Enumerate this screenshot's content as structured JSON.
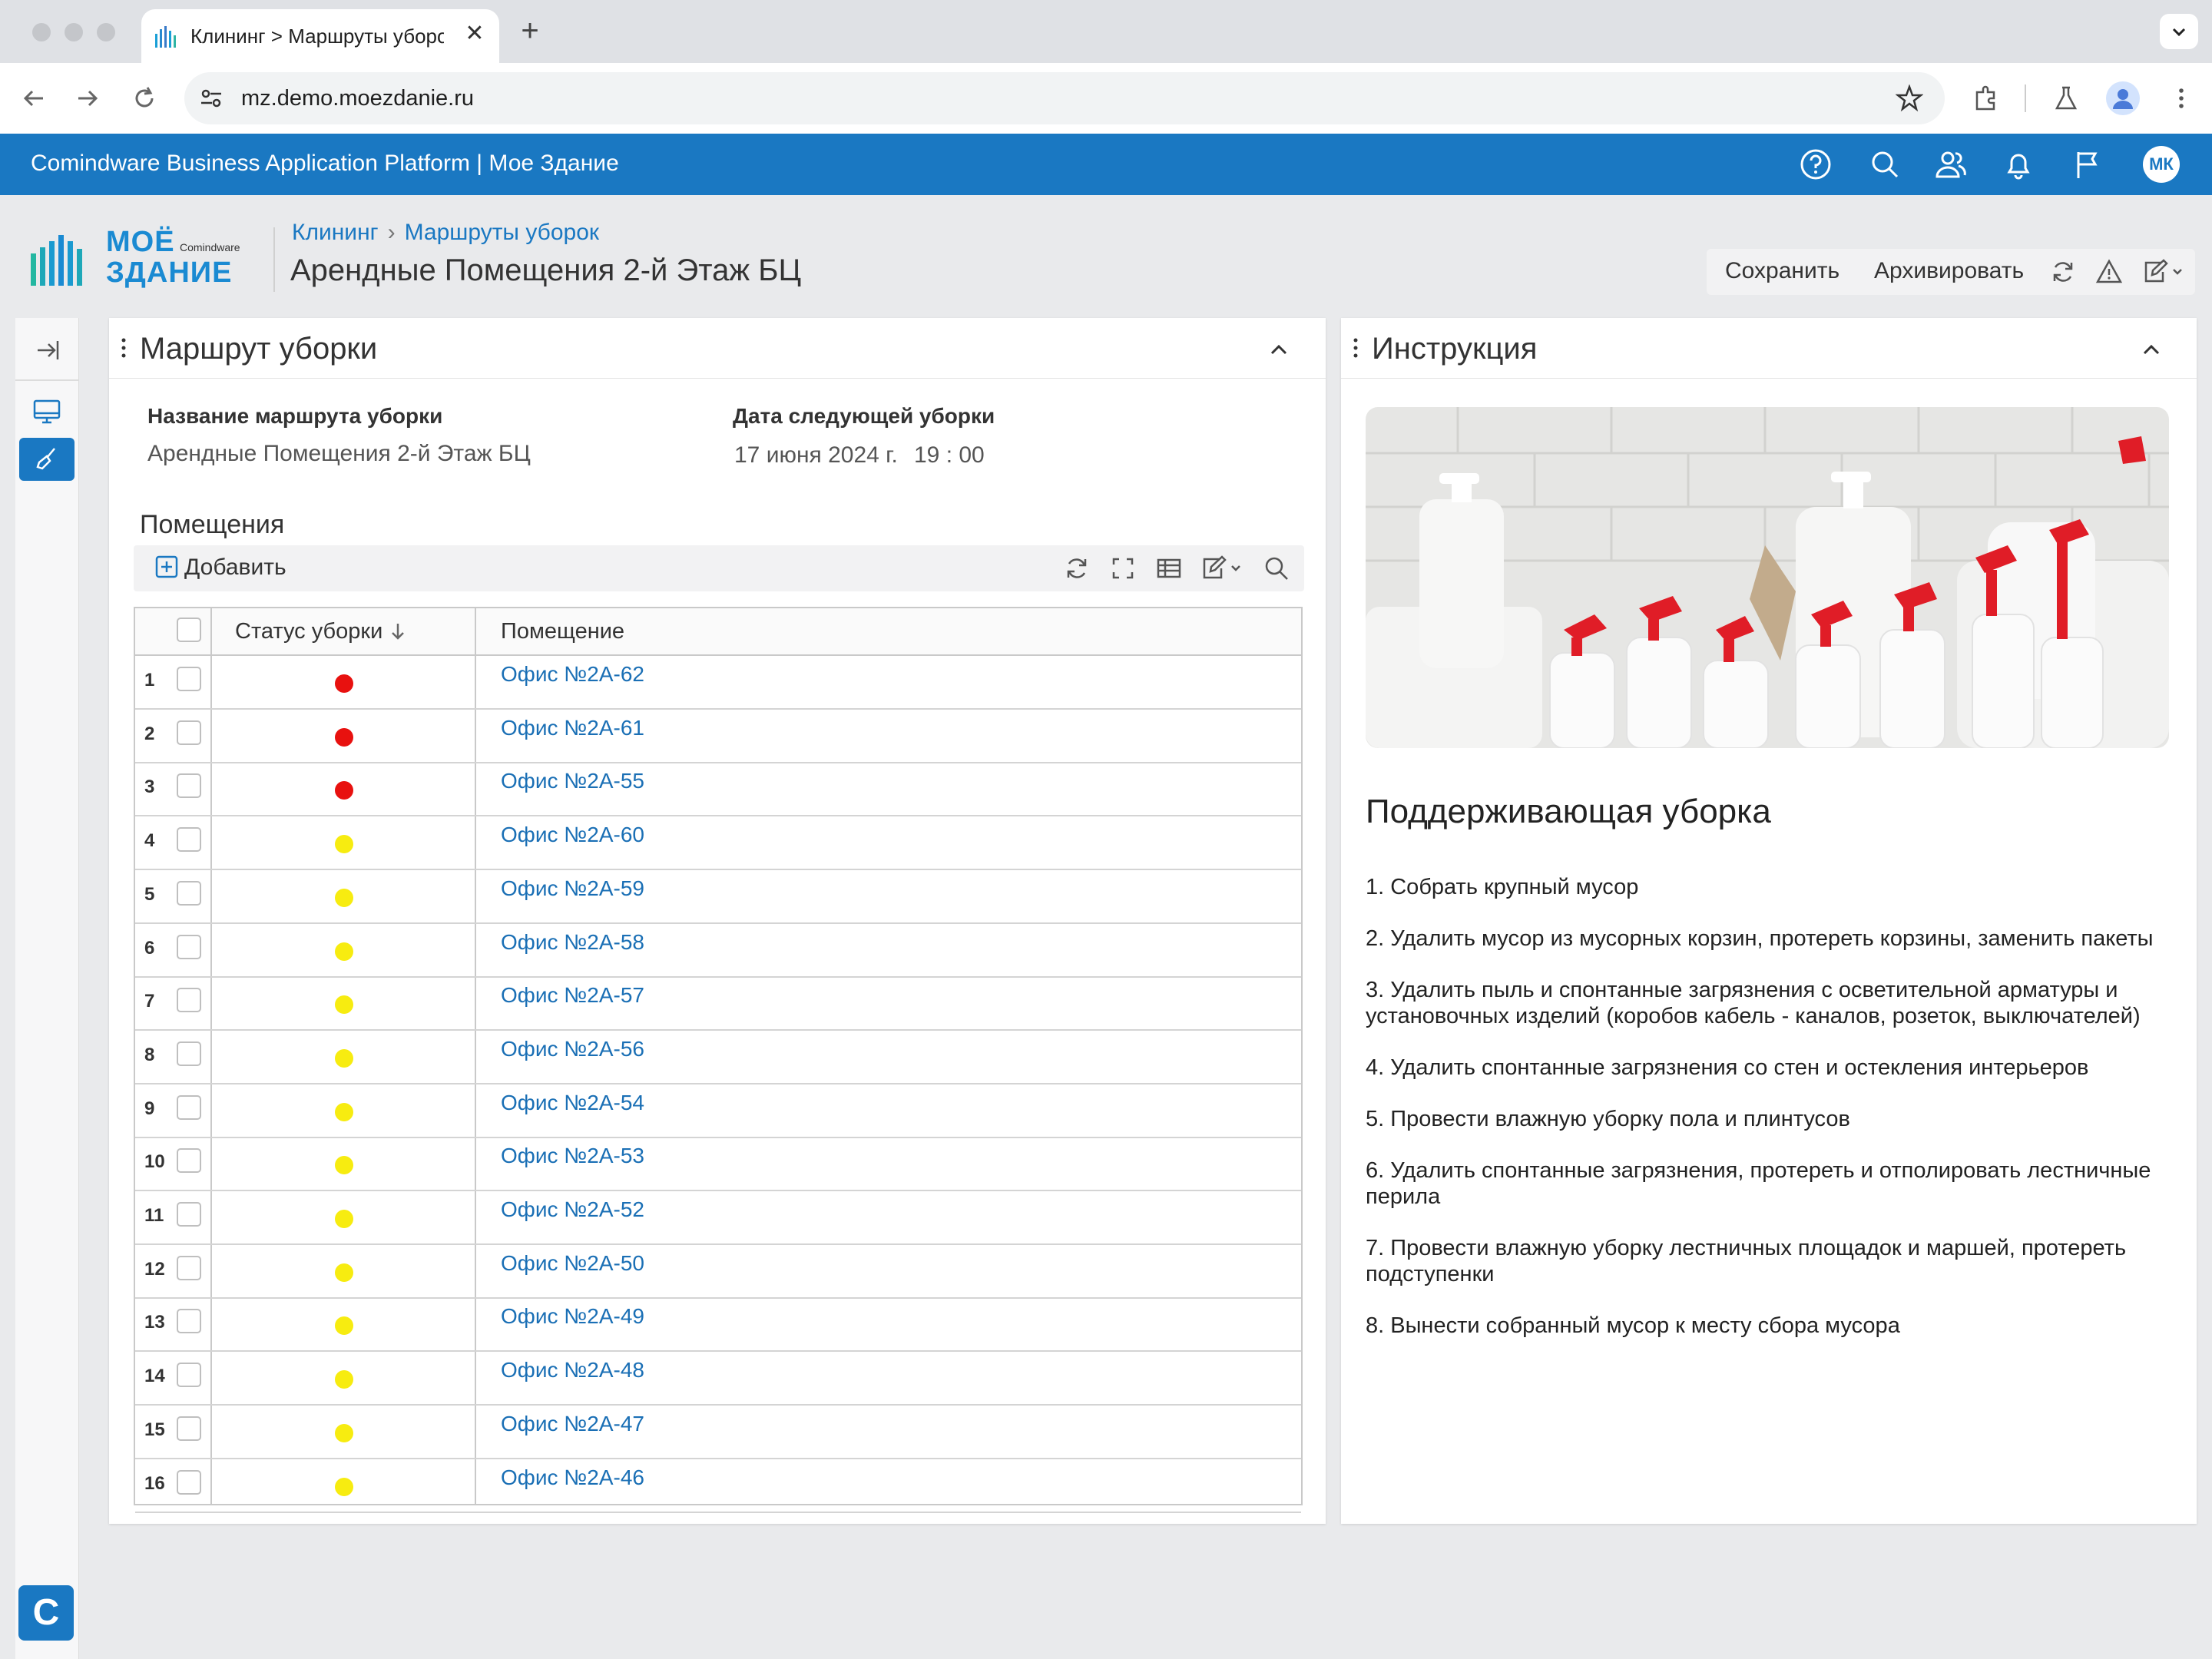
{
  "browser": {
    "tab_title": "Клининг > Маршруты уборок",
    "url": "mz.demo.moezdanie.ru"
  },
  "appbar": {
    "title": "Comindware Business Application Platform  |  Мое Здание",
    "user_initials": "МК"
  },
  "logo": {
    "line1": "МОЁ",
    "line2": "ЗДАНИЕ",
    "vendor": "Comindware"
  },
  "breadcrumbs": [
    "Клининг",
    "Маршруты уборок"
  ],
  "page_title": "Арендные Помещения 2-й Этаж БЦ",
  "actions": {
    "save": "Сохранить",
    "archive": "Архивировать"
  },
  "route_panel": {
    "title": "Маршрут уборки",
    "name_label": "Название маршрута уборки",
    "name_value": "Арендные Помещения 2-й Этаж БЦ",
    "date_label": "Дата следующей уборки",
    "date_value": "17 июня 2024 г.",
    "time_value": "19 : 00",
    "rooms_title": "Помещения",
    "add_label": "Добавить",
    "columns": [
      "Статус уборки",
      "Помещение"
    ],
    "status_colors": {
      "red": "#e8110f",
      "yellow": "#f7ec10"
    },
    "rows": [
      {
        "n": "1",
        "status": "red",
        "room": "Офис №2А-62"
      },
      {
        "n": "2",
        "status": "red",
        "room": "Офис №2А-61"
      },
      {
        "n": "3",
        "status": "red",
        "room": "Офис №2А-55"
      },
      {
        "n": "4",
        "status": "yellow",
        "room": "Офис №2А-60"
      },
      {
        "n": "5",
        "status": "yellow",
        "room": "Офис №2А-59"
      },
      {
        "n": "6",
        "status": "yellow",
        "room": "Офис №2А-58"
      },
      {
        "n": "7",
        "status": "yellow",
        "room": "Офис №2А-57"
      },
      {
        "n": "8",
        "status": "yellow",
        "room": "Офис №2А-56"
      },
      {
        "n": "9",
        "status": "yellow",
        "room": "Офис №2А-54"
      },
      {
        "n": "10",
        "status": "yellow",
        "room": "Офис №2А-53"
      },
      {
        "n": "11",
        "status": "yellow",
        "room": "Офис №2А-52"
      },
      {
        "n": "12",
        "status": "yellow",
        "room": "Офис №2А-50"
      },
      {
        "n": "13",
        "status": "yellow",
        "room": "Офис №2А-49"
      },
      {
        "n": "14",
        "status": "yellow",
        "room": "Офис №2А-48"
      },
      {
        "n": "15",
        "status": "yellow",
        "room": "Офис №2А-47"
      },
      {
        "n": "16",
        "status": "yellow",
        "room": "Офис №2А-46"
      }
    ]
  },
  "instruction_panel": {
    "title": "Инструкция",
    "heading": "Поддерживающая уборка",
    "steps": [
      "1. Собрать крупный мусор",
      "2. Удалить мусор из мусорных корзин, протереть корзины, заменить пакеты",
      "3. Удалить пыль и спонтанные загрязнения с осветительной арматуры и установочных изделий (коробов кабель - каналов, розеток, выключателей)",
      "4. Удалить спонтанные загрязнения со стен и остекления интерьеров",
      "5. Провести влажную уборку пола и плинтусов",
      "6. Удалить спонтанные загрязнения, протереть и отполировать лестничные перила",
      "7. Провести влажную уборку лестничных площадок и маршей, протереть подступенки",
      "8. Вынести собранный мусор к месту сбора мусора"
    ]
  },
  "rail": {
    "app_letter": "C"
  }
}
